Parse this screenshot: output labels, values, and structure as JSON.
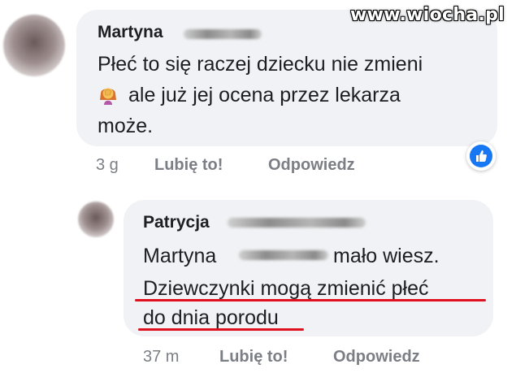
{
  "watermark": "www.wiocha.pl",
  "comments": [
    {
      "author": "Martyna",
      "lines": [
        "Płeć to się raczej dziecku nie zmieni",
        "ale już jej ocena przez lekarza",
        "może."
      ],
      "emoji": "facepalm-woman-icon",
      "time": "3 g",
      "like_label": "Lubię to!",
      "reply_label": "Odpowiedz",
      "reaction": "like-icon"
    },
    {
      "author": "Patrycja",
      "line1_prefix": "Martyna",
      "line1_suffix": "mało wiesz.",
      "lines": [
        "Dziewczynki mogą zmienić płeć",
        "do dnia porodu"
      ],
      "time": "37 m",
      "like_label": "Lubię to!",
      "reply_label": "Odpowiedz"
    }
  ],
  "colors": {
    "bubble": "#f0f2f5",
    "text": "#1c1e21",
    "meta": "#7b7f85",
    "underline": "#e0101f",
    "facebook_blue": "#1877f2"
  }
}
